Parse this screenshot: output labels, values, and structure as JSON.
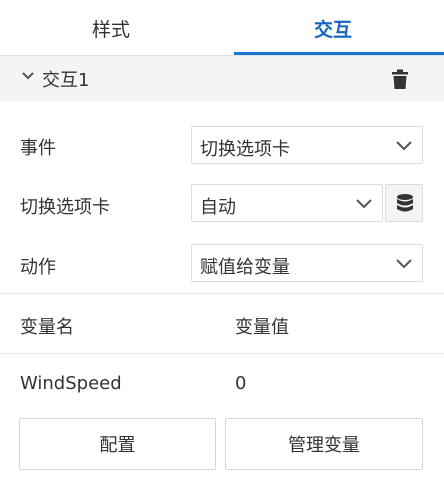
{
  "tabs": [
    {
      "label": "样式",
      "active": false
    },
    {
      "label": "交互",
      "active": true
    }
  ],
  "accent_color": "#1976d2",
  "section": {
    "title": "交互1",
    "collapse_icon": "chevron-down-icon",
    "delete_icon": "trash-icon"
  },
  "fields": {
    "event": {
      "label": "事件",
      "value": "切换选项卡"
    },
    "switch_tab": {
      "label": "切换选项卡",
      "value": "自动",
      "extra_icon": "database-icon"
    },
    "action": {
      "label": "动作",
      "value": "赋值给变量"
    }
  },
  "table": {
    "headers": [
      "变量名",
      "变量值"
    ],
    "rows": [
      [
        "WindSpeed",
        "0"
      ]
    ]
  },
  "buttons": {
    "configure": "配置",
    "manage_vars": "管理变量"
  }
}
